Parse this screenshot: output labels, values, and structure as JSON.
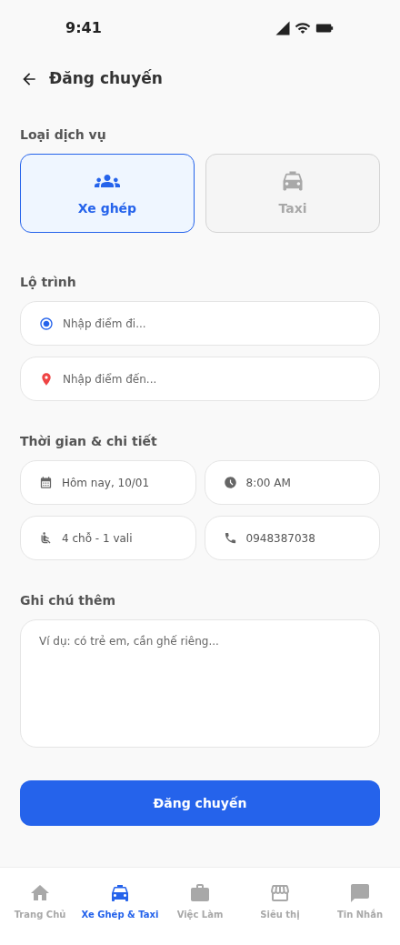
{
  "status_bar": {
    "time": "9:41"
  },
  "header": {
    "title": "Đăng chuyến"
  },
  "service": {
    "label": "Loại dịch vụ",
    "options": [
      {
        "kind": "group",
        "label": "Xe ghép",
        "selected": true
      },
      {
        "kind": "taxi",
        "label": "Taxi",
        "selected": false
      }
    ]
  },
  "route": {
    "label": "Lộ trình",
    "fields": [
      {
        "kind": "origin",
        "placeholder": "Nhập điểm đi..."
      },
      {
        "kind": "destination",
        "placeholder": "Nhập điểm đến..."
      }
    ]
  },
  "details": {
    "label": "Thời gian & chi tiết",
    "fields": [
      {
        "kind": "date",
        "value": "Hôm nay, 10/01"
      },
      {
        "kind": "time",
        "value": "8:00 AM"
      },
      {
        "kind": "seats",
        "value": "4 chỗ - 1 vali"
      },
      {
        "kind": "phone",
        "value": "0948387038"
      }
    ]
  },
  "note": {
    "label": "Ghi chú thêm",
    "placeholder": "Ví dụ: có trẻ em, cần ghế riêng..."
  },
  "submit": {
    "label": "Đăng chuyến"
  },
  "bottom_nav": [
    {
      "kind": "home",
      "label": "Trang Chủ",
      "selected": false
    },
    {
      "kind": "taxi",
      "label": "Xe Ghép & Taxi",
      "selected": true
    },
    {
      "kind": "jobs",
      "label": "Việc Làm",
      "selected": false
    },
    {
      "kind": "store",
      "label": "Siêu thị",
      "selected": false
    },
    {
      "kind": "chat",
      "label": "Tin Nhắn",
      "selected": false
    }
  ]
}
